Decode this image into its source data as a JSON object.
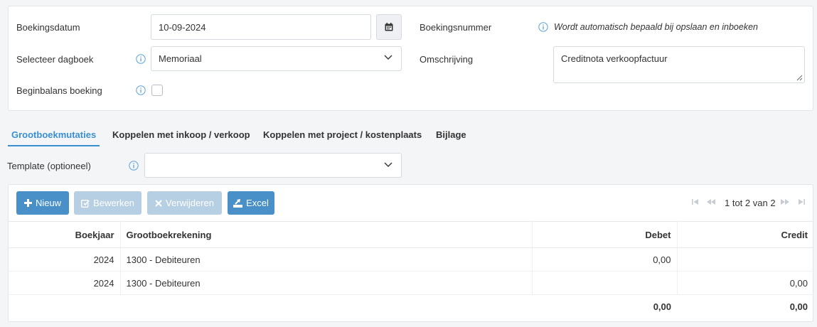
{
  "form": {
    "booking_date_label": "Boekingsdatum",
    "booking_date_value": "10-09-2024",
    "journal_label": "Selecteer dagboek",
    "journal_value": "Memoriaal",
    "opening_balance_label": "Beginbalans boeking",
    "booking_number_label": "Boekingsnummer",
    "booking_number_hint": "Wordt automatisch bepaald bij opslaan en inboeken",
    "description_label": "Omschrijving",
    "description_value": "Creditnota verkoopfactuur"
  },
  "tabs": [
    {
      "label": "Grootboekmutaties",
      "active": true
    },
    {
      "label": "Koppelen met inkoop / verkoop",
      "active": false
    },
    {
      "label": "Koppelen met project / kostenplaats",
      "active": false
    },
    {
      "label": "Bijlage",
      "active": false
    }
  ],
  "template": {
    "label": "Template (optioneel)",
    "value": ""
  },
  "toolbar": {
    "new_label": "Nieuw",
    "edit_label": "Bewerken",
    "delete_label": "Verwijderen",
    "excel_label": "Excel",
    "pager_text": "1 tot 2 van 2"
  },
  "table": {
    "headers": [
      "Boekjaar",
      "Grootboekrekening",
      "Debet",
      "Credit"
    ],
    "rows": [
      {
        "year": "2024",
        "account": "1300 - Debiteuren",
        "debit": "0,00",
        "credit": ""
      },
      {
        "year": "2024",
        "account": "1300 - Debiteuren",
        "debit": "",
        "credit": "0,00"
      }
    ],
    "totals": {
      "debit": "0,00",
      "credit": "0,00"
    }
  },
  "colors": {
    "accent": "#3a8fd0",
    "button_primary": "#4a90c8",
    "button_disabled": "#b6cfe3"
  }
}
